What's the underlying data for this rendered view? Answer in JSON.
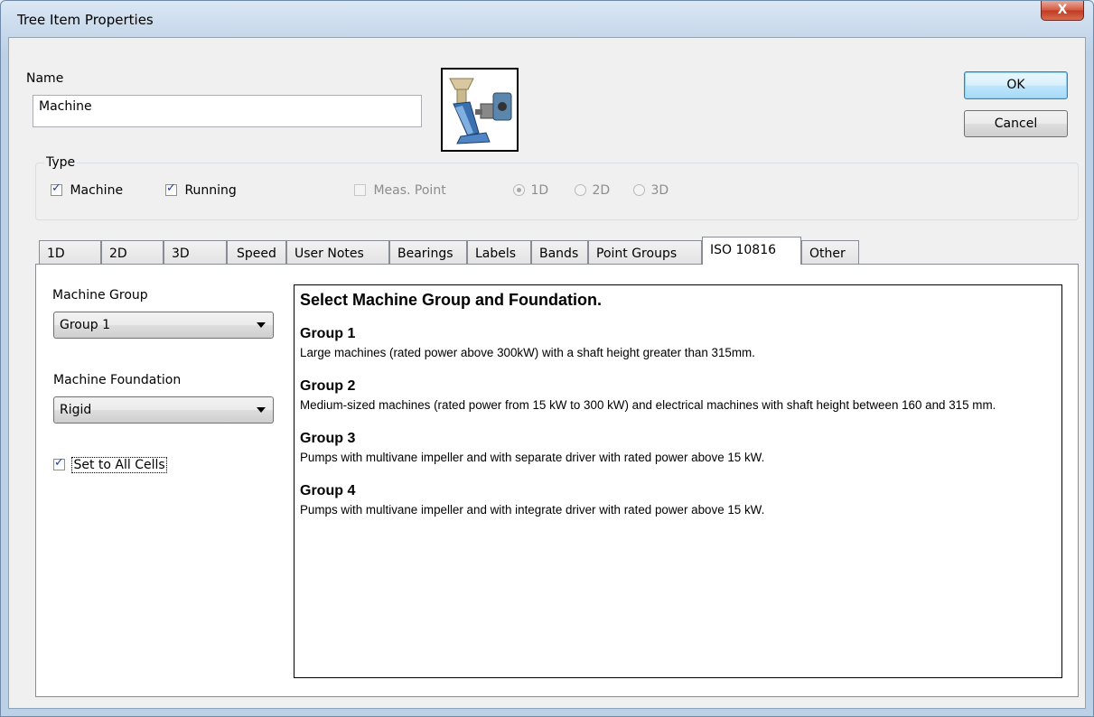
{
  "window": {
    "title": "Tree Item Properties",
    "close_label": "X"
  },
  "name_section": {
    "label": "Name",
    "value": "Machine"
  },
  "buttons": {
    "ok": "OK",
    "cancel": "Cancel"
  },
  "type": {
    "legend": "Type",
    "machine": {
      "label": "Machine",
      "checked": true
    },
    "running": {
      "label": "Running",
      "checked": true
    },
    "meas_point": {
      "label": "Meas. Point",
      "checked": false,
      "enabled": false
    },
    "dims": [
      {
        "label": "1D",
        "selected": true
      },
      {
        "label": "2D",
        "selected": false
      },
      {
        "label": "3D",
        "selected": false
      }
    ]
  },
  "tabs": [
    "1D",
    "2D",
    "3D",
    "Speed",
    "User Notes",
    "Bearings",
    "Labels",
    "Bands",
    "Point Groups",
    "ISO 10816",
    "Other"
  ],
  "active_tab": "ISO 10816",
  "iso": {
    "machine_group_label": "Machine Group",
    "machine_group_value": "Group 1",
    "machine_foundation_label": "Machine Foundation",
    "machine_foundation_value": "Rigid",
    "set_all_label": "Set to All Cells",
    "set_all_checked": true
  },
  "info": {
    "heading": "Select Machine Group and Foundation.",
    "groups": [
      {
        "title": "Group 1",
        "desc": "Large machines (rated power above 300kW) with a shaft height greater than 315mm."
      },
      {
        "title": "Group 2",
        "desc": "Medium-sized machines (rated power from 15 kW to 300 kW) and electrical machines with shaft height between 160 and 315 mm."
      },
      {
        "title": "Group 3",
        "desc": "Pumps with multivane impeller and with separate driver with rated power above 15 kW."
      },
      {
        "title": "Group 4",
        "desc": "Pumps with multivane impeller and with integrate driver with rated power above 15 kW."
      }
    ]
  },
  "icons": {
    "machine_image": "machine-icon",
    "close": "close-icon",
    "dropdown": "chevron-down-icon"
  },
  "colors": {
    "close_button": "#c7432a",
    "default_button_border": "#3c7fb1",
    "checkmark": "#2a3f8c"
  }
}
